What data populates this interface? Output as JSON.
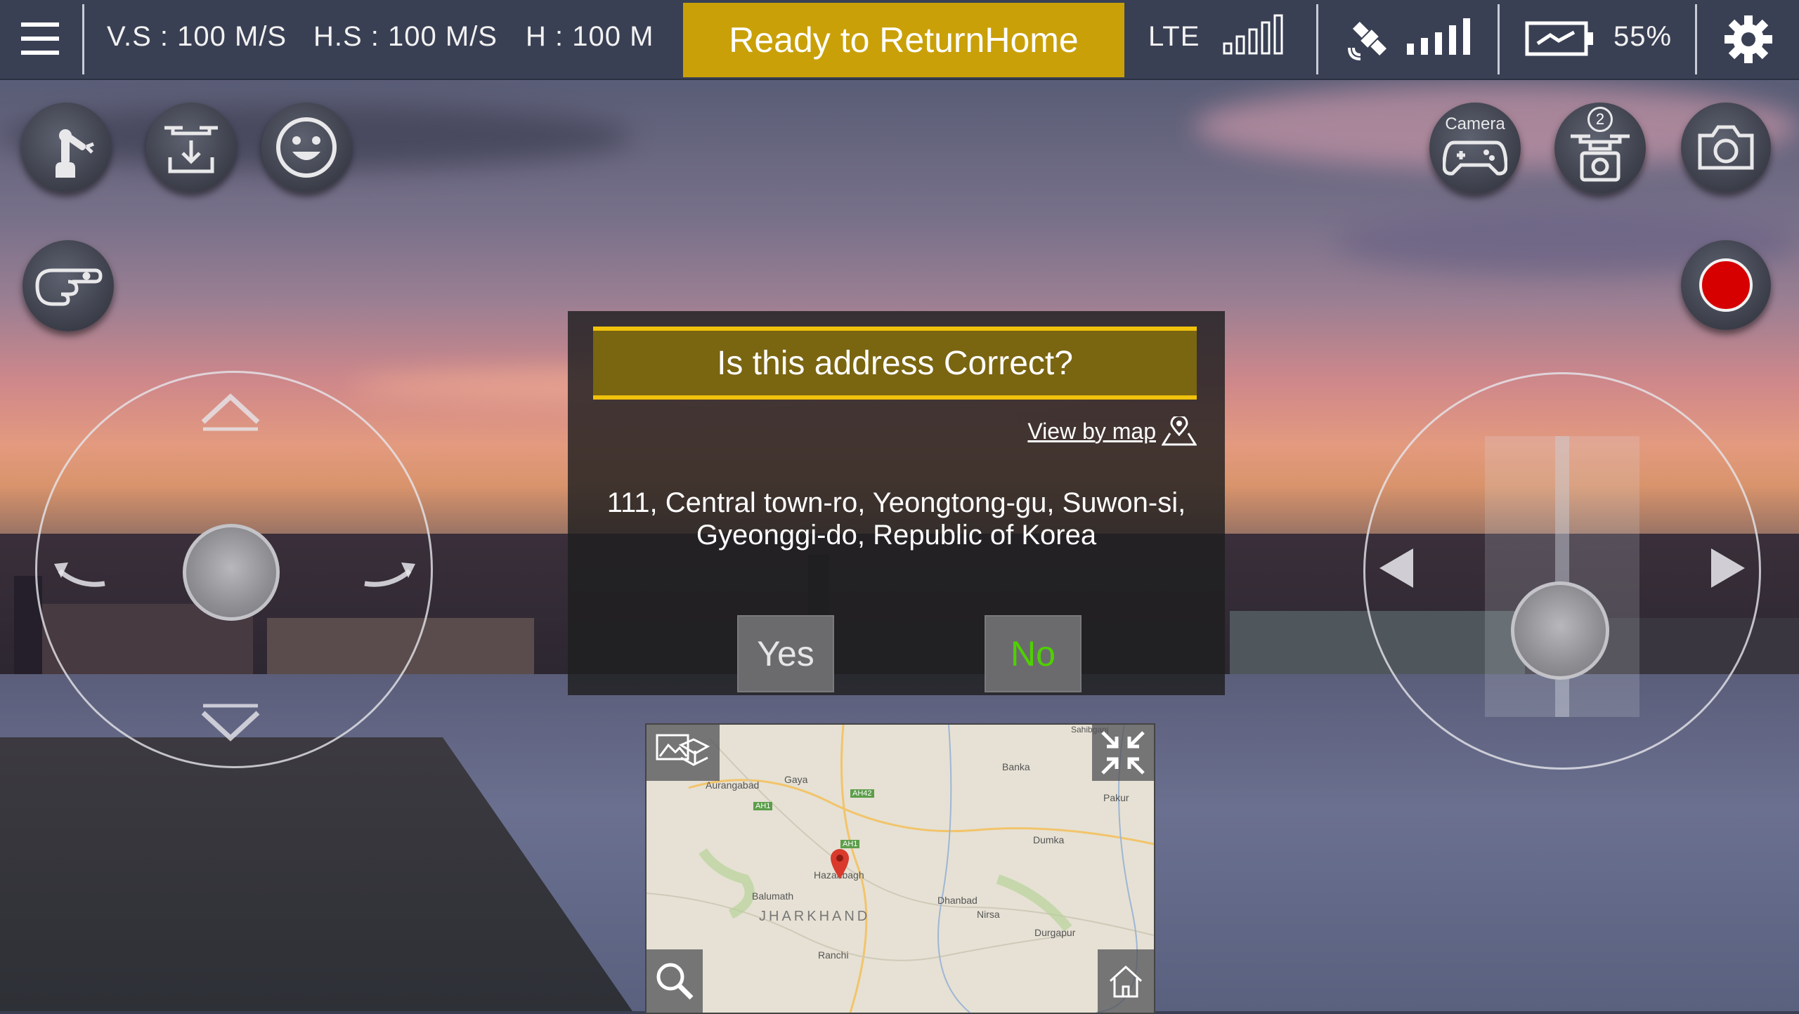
{
  "topbar": {
    "menu_icon": "hamburger-menu-icon",
    "vs_label": "V.S : 100 M/S",
    "hs_label": "H.S : 100 M/S",
    "h_label": "H : 100 M",
    "status_banner": "Ready to ReturnHome",
    "network_type": "LTE",
    "battery_level": "55%",
    "battery_fraction": 0.55,
    "settings_icon": "gear-icon"
  },
  "left_controls": {
    "arm_icon": "robot-arm-icon",
    "land_icon": "drone-land-icon",
    "face_icon": "smiley-face-icon",
    "gesture_icon": "hand-gesture-icon"
  },
  "right_controls": {
    "camera_button_label": "Camera",
    "gamepad_icon": "gamepad-icon",
    "drone_camera_badge": "2",
    "drone_camera_icon": "drone-camera-icon",
    "photo_icon": "camera-icon",
    "record_icon": "record-icon"
  },
  "dialog": {
    "title": "Is this address Correct?",
    "view_by_map": "View by map",
    "address_line1": "111, Central town-ro, Yeongtong-gu, Suwon-si,",
    "address_line2": "Gyeonggi-do, Republic of Korea",
    "yes_label": "Yes",
    "no_label": "No"
  },
  "map": {
    "labels": [
      "Aurangabad",
      "Gaya",
      "AH42",
      "AH1",
      "Banka",
      "Pakur",
      "AH1",
      "Hazaribagh",
      "Dumka",
      "Balumath",
      "Dhanbad",
      "Nirsa",
      "Durgapur",
      "Ranchi",
      "Sahibganj"
    ],
    "region": "JHARKHAND"
  },
  "colors": {
    "accent_gold": "#c9a008",
    "dialog_border": "#f0c20c",
    "no_green": "#4ed100",
    "record_red": "#d60000"
  }
}
